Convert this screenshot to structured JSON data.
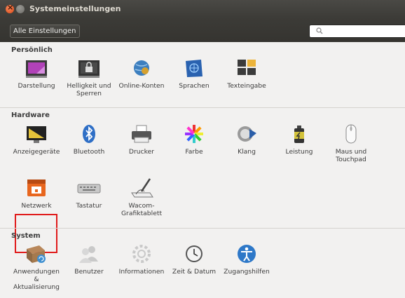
{
  "window": {
    "title": "Systemeinstellungen"
  },
  "toolbar": {
    "all_settings_label": "Alle Einstellungen",
    "search_placeholder": ""
  },
  "sections": {
    "personal": {
      "title": "Persönlich",
      "items": [
        {
          "label": "Darstellung"
        },
        {
          "label": "Helligkeit und Sperren"
        },
        {
          "label": "Online-Konten"
        },
        {
          "label": "Sprachen"
        },
        {
          "label": "Texteingabe"
        }
      ]
    },
    "hardware": {
      "title": "Hardware",
      "items": [
        {
          "label": "Anzeigegeräte"
        },
        {
          "label": "Bluetooth"
        },
        {
          "label": "Drucker"
        },
        {
          "label": "Farbe"
        },
        {
          "label": "Klang"
        },
        {
          "label": "Leistung"
        },
        {
          "label": "Maus und Touchpad"
        },
        {
          "label": "Netzwerk"
        },
        {
          "label": "Tastatur"
        },
        {
          "label": "Wacom-Grafiktablett"
        }
      ]
    },
    "system": {
      "title": "System",
      "items": [
        {
          "label": "Anwendungen & Aktualisierung"
        },
        {
          "label": "Benutzer"
        },
        {
          "label": "Informationen"
        },
        {
          "label": "Zeit & Datum"
        },
        {
          "label": "Zugangshilfen"
        }
      ]
    }
  },
  "icons": {
    "personal": [
      "appearance-icon",
      "brightness-lock-icon",
      "online-accounts-icon",
      "language-icon",
      "text-entry-icon"
    ],
    "hardware": [
      "display-icon",
      "bluetooth-icon",
      "printer-icon",
      "color-icon",
      "sound-icon",
      "power-icon",
      "mouse-icon",
      "network-icon",
      "keyboard-icon",
      "wacom-tablet-icon"
    ],
    "system": [
      "software-updates-icon",
      "users-icon",
      "details-icon",
      "date-time-icon",
      "accessibility-icon"
    ]
  },
  "highlight": {
    "color": "#e01b1b",
    "item": "Netzwerk"
  }
}
